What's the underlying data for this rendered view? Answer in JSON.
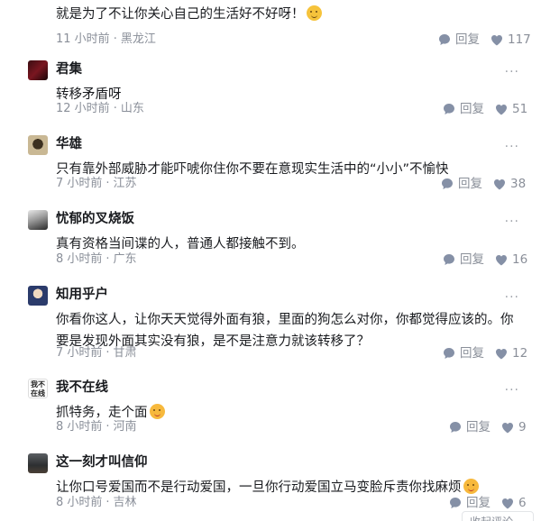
{
  "comments": [
    {
      "author": "",
      "content": "就是为了不让你关心自己的生活好不好呀！",
      "emoji": "thinking-emoji",
      "time": "11 小时前",
      "location": "黑龙江",
      "reply_label": "回复",
      "likes": "117"
    },
    {
      "author": "君集",
      "content": "转移矛盾呀",
      "time": "12 小时前",
      "location": "山东",
      "reply_label": "回复",
      "likes": "51"
    },
    {
      "author": "华雄",
      "content": "只有靠外部威胁才能吓唬你住你不要在意现实生活中的“小小”不愉快",
      "time": "7 小时前",
      "location": "江苏",
      "reply_label": "回复",
      "likes": "38"
    },
    {
      "author": "忧郁的叉烧饭",
      "content": "真有资格当间谍的人，普通人都接触不到。",
      "time": "8 小时前",
      "location": "广东",
      "reply_label": "回复",
      "likes": "16"
    },
    {
      "author": "知用乎户",
      "content": "你看你这人，让你天天觉得外面有狼，里面的狗怎么对你，你都觉得应该的。你要是发现外面其实没有狼，是不是注意力就该转移了？",
      "time": "7 小时前",
      "location": "甘肃",
      "reply_label": "回复",
      "likes": "12"
    },
    {
      "author": "我不在线",
      "avatar_text": "我不在线",
      "content": "抓特务，走个面",
      "emoji": "blush-emoji",
      "time": "8 小时前",
      "location": "河南",
      "reply_label": "回复",
      "likes": "9"
    },
    {
      "author": "这一刻才叫信仰",
      "content": "让你口号爱国而不是行动爱国，一旦你行动爱国立马变脸斥责你找麻烦",
      "emoji": "blush-emoji",
      "time": "8 小时前",
      "location": "吉林",
      "reply_label": "回复",
      "likes": "6"
    }
  ],
  "collapse_label": "收起评论",
  "separator": "·",
  "more_label": "···",
  "colors": {
    "text": "#191b1f",
    "meta": "#8a8f99",
    "icon": "#8590a6"
  }
}
